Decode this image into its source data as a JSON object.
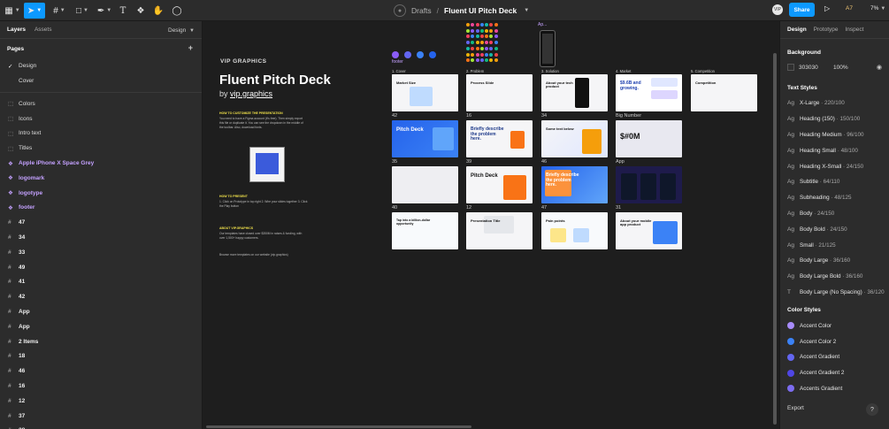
{
  "toolbar": {
    "breadcrumb_root": "Drafts",
    "breadcrumb_sep": "/",
    "file_name": "Fluent UI Pitch Deck",
    "share_label": "Share",
    "ai_label": "A7",
    "zoom": "7%",
    "avatar_initials": "VIP"
  },
  "left": {
    "tabs": [
      "Layers",
      "Assets"
    ],
    "design_label": "Design",
    "pages_heading": "Pages",
    "pages": [
      "Design",
      "Cover"
    ],
    "layers": [
      {
        "label": "Colors",
        "kind": "group"
      },
      {
        "label": "Icons",
        "kind": "group"
      },
      {
        "label": "Intro text",
        "kind": "group"
      },
      {
        "label": "Titles",
        "kind": "group"
      },
      {
        "label": "Apple iPhone X Space Grey",
        "kind": "comp"
      },
      {
        "label": "logomark",
        "kind": "comp"
      },
      {
        "label": "logotype",
        "kind": "comp"
      },
      {
        "label": "footer",
        "kind": "comp"
      },
      {
        "label": "47",
        "kind": "frame"
      },
      {
        "label": "34",
        "kind": "frame"
      },
      {
        "label": "33",
        "kind": "frame"
      },
      {
        "label": "49",
        "kind": "frame"
      },
      {
        "label": "41",
        "kind": "frame"
      },
      {
        "label": "42",
        "kind": "frame"
      },
      {
        "label": "App",
        "kind": "frame"
      },
      {
        "label": "App",
        "kind": "frame"
      },
      {
        "label": "2 Items",
        "kind": "frame"
      },
      {
        "label": "18",
        "kind": "frame"
      },
      {
        "label": "46",
        "kind": "frame"
      },
      {
        "label": "16",
        "kind": "frame"
      },
      {
        "label": "12",
        "kind": "frame"
      },
      {
        "label": "37",
        "kind": "frame"
      },
      {
        "label": "38",
        "kind": "frame"
      }
    ]
  },
  "canvas": {
    "doc_logo": "VIP GRAPHICS",
    "doc_title": "Fluent Pitch Deck",
    "doc_by": "by",
    "doc_by_link": "vip.graphics",
    "doc_h1": "HOW TO CUSTOMIZE THE PRESENTATION",
    "doc_p1": "You need to have a Figma account (it's free). Then simply export this file or duplicate it. You can see the dropdown in the middle of the toolbar. Also, download fonts.",
    "doc_h2": "HOW TO PRESENT",
    "doc_p2": "1. Click on Prototype in top right  2. Wire your slides together  3. Click the Play button",
    "doc_h3": "ABOUT VIP.GRAPHICS",
    "doc_p3": "Our templates have closed over $350M in raises & funding, with over 1,500+ happy customers.",
    "doc_p4": "Browse more templates on our website (vip.graphics)",
    "footer_label": "footer",
    "app_label": "Ap...",
    "slides": [
      {
        "label": "1. Cover",
        "title": "Pitch Deck"
      },
      {
        "label": "2. Problem",
        "title": "Process Slide"
      },
      {
        "label": "3. Solution",
        "title": "About your tech product"
      },
      {
        "label": "4. Market",
        "title": "$9.6B and growing."
      },
      {
        "label": "5. Competition",
        "title": "Competition"
      },
      {
        "label": "42",
        "title": "Pitch Deck"
      },
      {
        "label": "16",
        "title": "Briefly describe the problem here."
      },
      {
        "label": "34",
        "title": "Some text below"
      },
      {
        "label": "Big Number",
        "title": "$#0M"
      },
      {
        "label": "35",
        "title": ""
      },
      {
        "label": "39",
        "title": "Pitch Deck"
      },
      {
        "label": "46",
        "title": "Briefly describe the problem here."
      },
      {
        "label": "App",
        "title": ""
      },
      {
        "label": "40",
        "title": "Tap into a billion-dollar opportunity"
      },
      {
        "label": "12",
        "title": "Presentation Title"
      },
      {
        "label": "47",
        "title": "Pain points"
      },
      {
        "label": "31",
        "title": "About your mobile app product"
      },
      {
        "label": "43",
        "title": "Market Size"
      }
    ]
  },
  "right": {
    "tabs": [
      "Design",
      "Prototype",
      "Inspect"
    ],
    "background_heading": "Background",
    "bg_hex": "303030",
    "bg_opacity": "100%",
    "text_styles_heading": "Text Styles",
    "text_styles": [
      {
        "name": "X-Large",
        "meta": "220/100"
      },
      {
        "name": "Heading (150)",
        "meta": "150/100"
      },
      {
        "name": "Heading Medium",
        "meta": "96/100"
      },
      {
        "name": "Heading Small",
        "meta": "48/100"
      },
      {
        "name": "Heading X-Small",
        "meta": "24/150"
      },
      {
        "name": "Subtitle",
        "meta": "64/110"
      },
      {
        "name": "Subheading",
        "meta": "48/125"
      },
      {
        "name": "Body",
        "meta": "24/150"
      },
      {
        "name": "Body Bold",
        "meta": "24/150"
      },
      {
        "name": "Small",
        "meta": "21/125"
      },
      {
        "name": "Body Large",
        "meta": "36/160"
      },
      {
        "name": "Body Large Bold",
        "meta": "36/160"
      },
      {
        "name": "Body Large (No Spacing)",
        "meta": "36/120"
      }
    ],
    "color_styles_heading": "Color Styles",
    "color_styles": [
      {
        "name": "Accent Color",
        "color": "#a78bfa"
      },
      {
        "name": "Accent Color 2",
        "color": "#3b82f6"
      },
      {
        "name": "Accent Gradient",
        "color": "#6366f1"
      },
      {
        "name": "Accent Gradient 2",
        "color": "#4f46e5"
      },
      {
        "name": "Accents Gradient",
        "color": "#7c6cf0"
      }
    ],
    "export_label": "Export",
    "help_label": "?"
  },
  "colors": {
    "accent": "#0d99ff",
    "component": "#c4a1ff",
    "panel": "#2c2c2c",
    "canvas": "#1e1e1e"
  }
}
